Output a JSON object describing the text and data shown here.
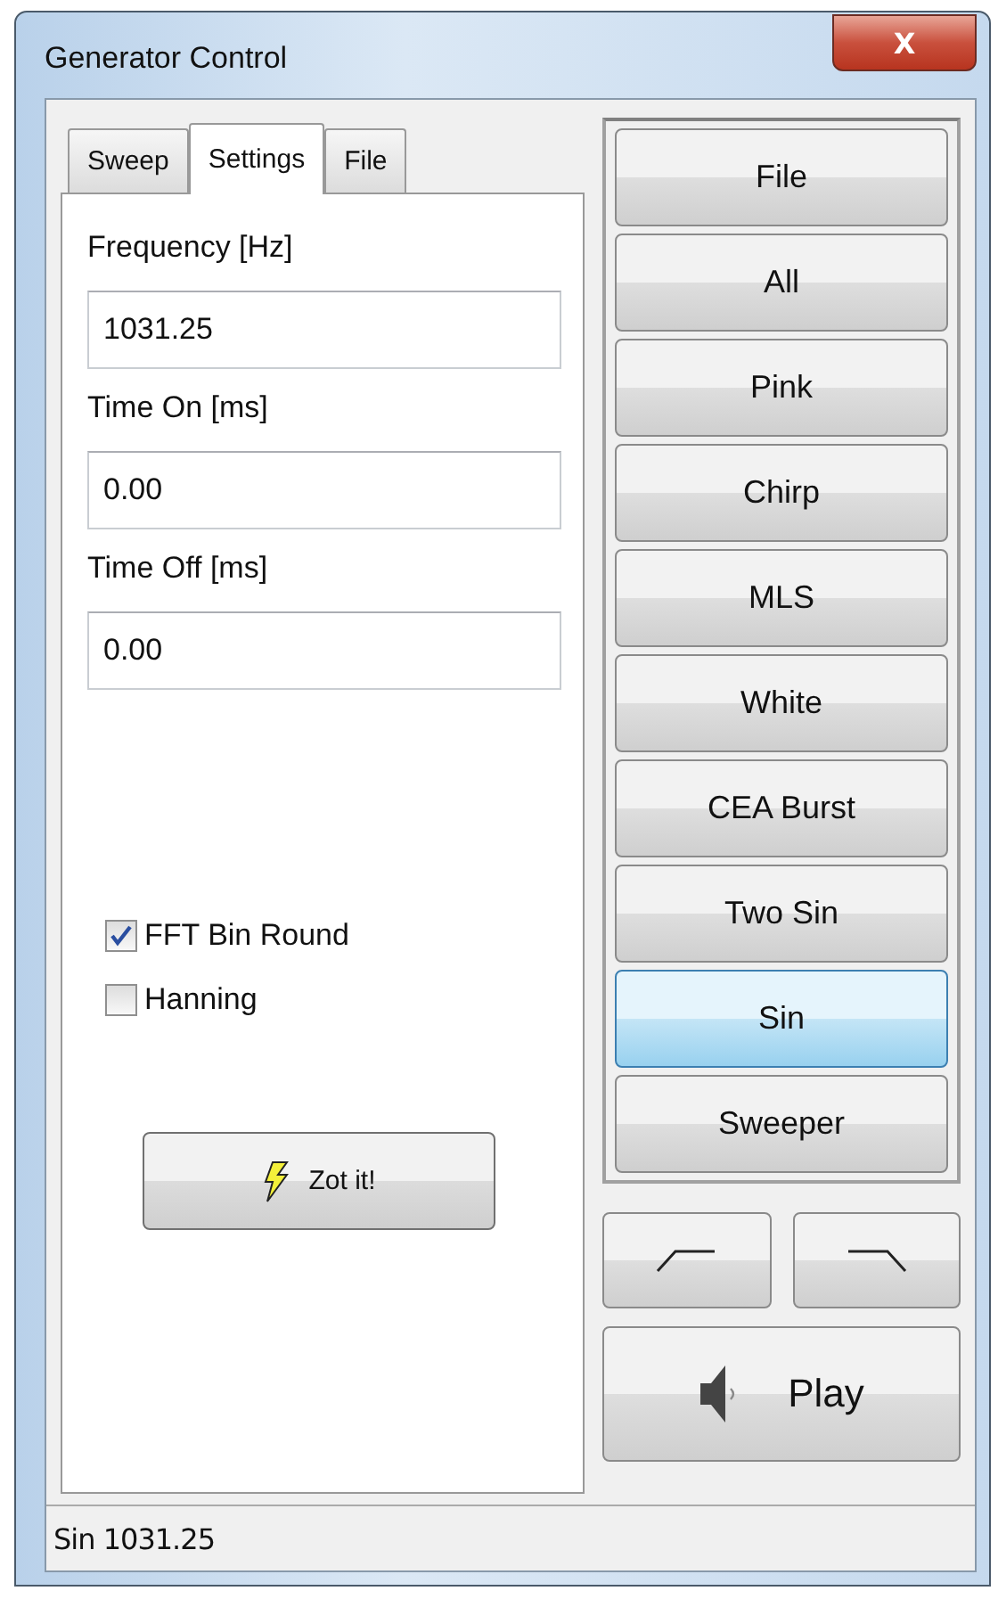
{
  "window": {
    "title": "Generator Control",
    "close": "X"
  },
  "tabs": [
    {
      "label": "Sweep",
      "selected": false
    },
    {
      "label": "Settings",
      "selected": true
    },
    {
      "label": "File",
      "selected": false
    }
  ],
  "fields": [
    {
      "label": "Frequency [Hz]",
      "value": "1031.25"
    },
    {
      "label": "Time On [ms]",
      "value": "0.00"
    },
    {
      "label": "Time Off [ms]",
      "value": "0.00"
    }
  ],
  "checkboxes": [
    {
      "label": "FFT Bin Round",
      "checked": true
    },
    {
      "label": "Hanning",
      "checked": false
    }
  ],
  "zot_button": "Zot it!",
  "signal_buttons": [
    {
      "label": "File",
      "selected": false
    },
    {
      "label": "All",
      "selected": false
    },
    {
      "label": "Pink",
      "selected": false
    },
    {
      "label": "Chirp",
      "selected": false
    },
    {
      "label": "MLS",
      "selected": false
    },
    {
      "label": "White",
      "selected": false
    },
    {
      "label": "CEA Burst",
      "selected": false
    },
    {
      "label": "Two Sin",
      "selected": false
    },
    {
      "label": "Sin",
      "selected": true
    },
    {
      "label": "Sweeper",
      "selected": false
    }
  ],
  "play_button": "Play",
  "status_bar": "Sin 1031.25"
}
